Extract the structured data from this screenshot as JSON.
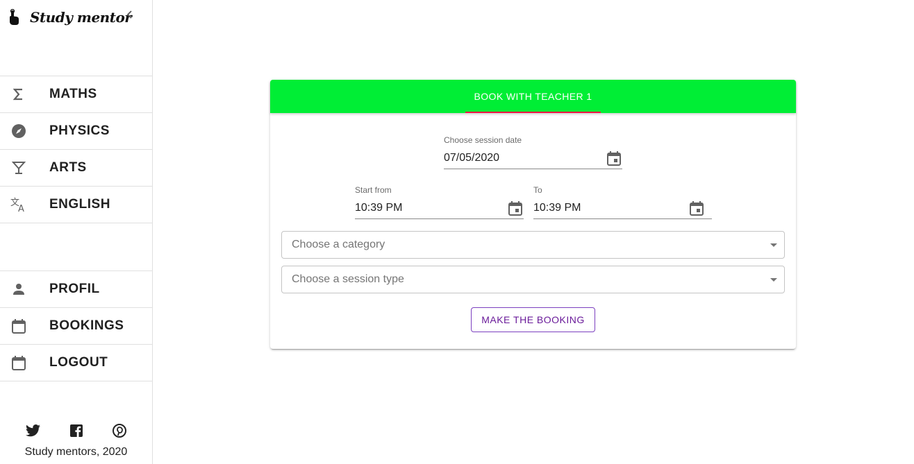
{
  "brand": {
    "name": "Study mentor",
    "logo_icon": "touch-hand-icon",
    "collapse_icon": "chevron-left-icon"
  },
  "nav_top": [
    {
      "label": "MATHS",
      "icon": "sigma-icon"
    },
    {
      "label": "PHYSICS",
      "icon": "compass-icon"
    },
    {
      "label": "ARTS",
      "icon": "cocktail-glass-icon"
    },
    {
      "label": "ENGLISH",
      "icon": "translate-icon"
    }
  ],
  "nav_bottom": [
    {
      "label": "PROFIL",
      "icon": "person-icon"
    },
    {
      "label": "BOOKINGS",
      "icon": "calendar-icon"
    },
    {
      "label": "LOGOUT",
      "icon": "calendar-icon"
    }
  ],
  "footer": {
    "social": [
      "twitter-icon",
      "facebook-icon",
      "pinterest-icon"
    ],
    "copyright": "Study mentors, 2020"
  },
  "booking": {
    "tab_label": "BOOK WITH TEACHER 1",
    "header_color": "#00ee35",
    "indicator_color": "#ff1744",
    "date": {
      "label": "Choose session date",
      "value": "07/05/2020"
    },
    "start": {
      "label": "Start from",
      "value": "10:39 PM"
    },
    "end": {
      "label": "To",
      "value": "10:39 PM"
    },
    "category_placeholder": "Choose a category",
    "session_type_placeholder": "Choose a session type",
    "submit_label": "MAKE THE BOOKING"
  }
}
